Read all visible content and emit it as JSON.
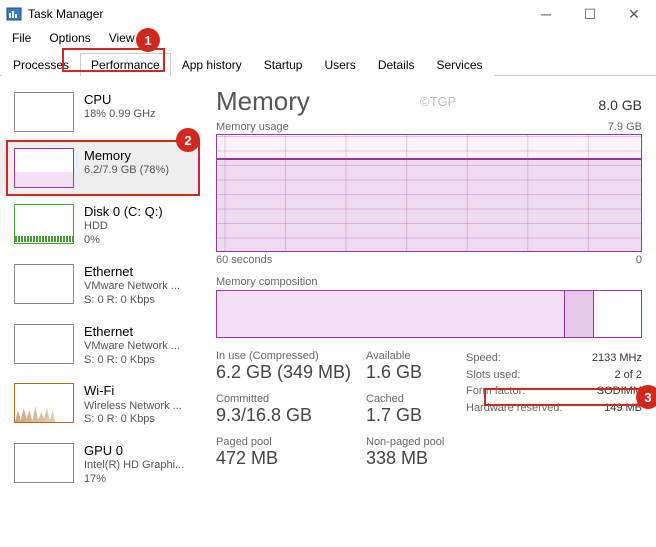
{
  "window": {
    "title": "Task Manager"
  },
  "menu": {
    "file": "File",
    "options": "Options",
    "view": "View"
  },
  "tabs": {
    "processes": "Processes",
    "performance": "Performance",
    "app_history": "App history",
    "startup": "Startup",
    "users": "Users",
    "details": "Details",
    "services": "Services"
  },
  "sidebar": {
    "items": [
      {
        "name": "CPU",
        "sub1": "18%  0.99 GHz",
        "sub2": ""
      },
      {
        "name": "Memory",
        "sub1": "6.2/7.9 GB (78%)",
        "sub2": ""
      },
      {
        "name": "Disk 0 (C: Q:)",
        "sub1": "HDD",
        "sub2": "0%"
      },
      {
        "name": "Ethernet",
        "sub1": "VMware Network ...",
        "sub2": "S: 0  R: 0 Kbps"
      },
      {
        "name": "Ethernet",
        "sub1": "VMware Network ...",
        "sub2": "S: 0  R: 0 Kbps"
      },
      {
        "name": "Wi-Fi",
        "sub1": "Wireless Network ...",
        "sub2": "S: 0  R: 0 Kbps"
      },
      {
        "name": "GPU 0",
        "sub1": "Intel(R) HD Graphi...",
        "sub2": "17%"
      }
    ]
  },
  "detail": {
    "title": "Memory",
    "total": "8.0 GB",
    "usage_chart": {
      "label": "Memory usage",
      "max": "7.9 GB",
      "axis_left": "60 seconds",
      "axis_right": "0"
    },
    "comp_label": "Memory composition",
    "stats": {
      "in_use_label": "In use (Compressed)",
      "in_use_value": "6.2 GB (349 MB)",
      "available_label": "Available",
      "available_value": "1.6 GB",
      "committed_label": "Committed",
      "committed_value": "9.3/16.8 GB",
      "cached_label": "Cached",
      "cached_value": "1.7 GB",
      "paged_label": "Paged pool",
      "paged_value": "472 MB",
      "nonpaged_label": "Non-paged pool",
      "nonpaged_value": "338 MB"
    },
    "hw": {
      "speed_k": "Speed:",
      "speed_v": "2133 MHz",
      "slots_k": "Slots used:",
      "slots_v": "2 of 2",
      "form_k": "Form factor:",
      "form_v": "SODIMM",
      "reserved_k": "Hardware reserved:",
      "reserved_v": "149 MB"
    }
  },
  "watermark": "©TGP",
  "annotations": {
    "b1": "1",
    "b2": "2",
    "b3": "3"
  }
}
